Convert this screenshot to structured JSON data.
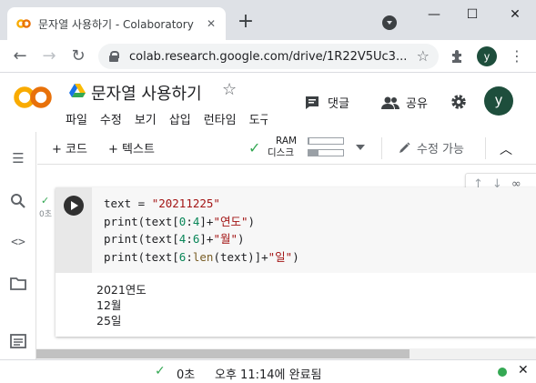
{
  "browser": {
    "tab_title": "문자열 사용하기 - Colaboratory",
    "tab_close": "✕",
    "new_tab": "+",
    "url": "colab.research.google.com/drive/1R22V5Uc3...",
    "profile_initial": "y",
    "window_controls": {
      "minimize": "—",
      "maximize": "☐",
      "close": "✕"
    }
  },
  "colab": {
    "doc_title": "문자열 사용하기",
    "menu": [
      "파일",
      "수정",
      "보기",
      "삽입",
      "런타임",
      "도구"
    ],
    "comment_label": "댓글",
    "share_label": "공유",
    "profile_initial": "y"
  },
  "toolbar": {
    "add_code": "+ 코드",
    "add_text": "+ 텍스트",
    "ram_label": "RAM",
    "disk_label": "디스크",
    "ram_usage": 0.02,
    "disk_usage": 0.3,
    "edit_mode": "수정 가능"
  },
  "cell": {
    "exec_time": "0초",
    "code": {
      "line1": {
        "a": "text = ",
        "b": "\"20211225\""
      },
      "line2": {
        "a": "print(text[",
        "n1": "0",
        "c": ":",
        "n2": "4",
        "d": "]+",
        "s": "\"연도\"",
        "e": ")"
      },
      "line3": {
        "a": "print(text[",
        "n1": "4",
        "c": ":",
        "n2": "6",
        "d": "]+",
        "s": "\"월\"",
        "e": ")"
      },
      "line4": {
        "a": "print(text[",
        "n1": "6",
        "c": ":",
        "fn": "len",
        "m": "(text)]+",
        "s": "\"일\"",
        "e": ")"
      }
    },
    "output": [
      "2021연도",
      "12월",
      "25일"
    ]
  },
  "statusbar": {
    "time": "0초",
    "message": "오후 11:14에 완료됨",
    "close": "✕"
  },
  "colors": {
    "accent_green": "#34a853",
    "string_red": "#a31515",
    "number_green": "#098658",
    "avatar_bg": "#1e4e3c"
  }
}
